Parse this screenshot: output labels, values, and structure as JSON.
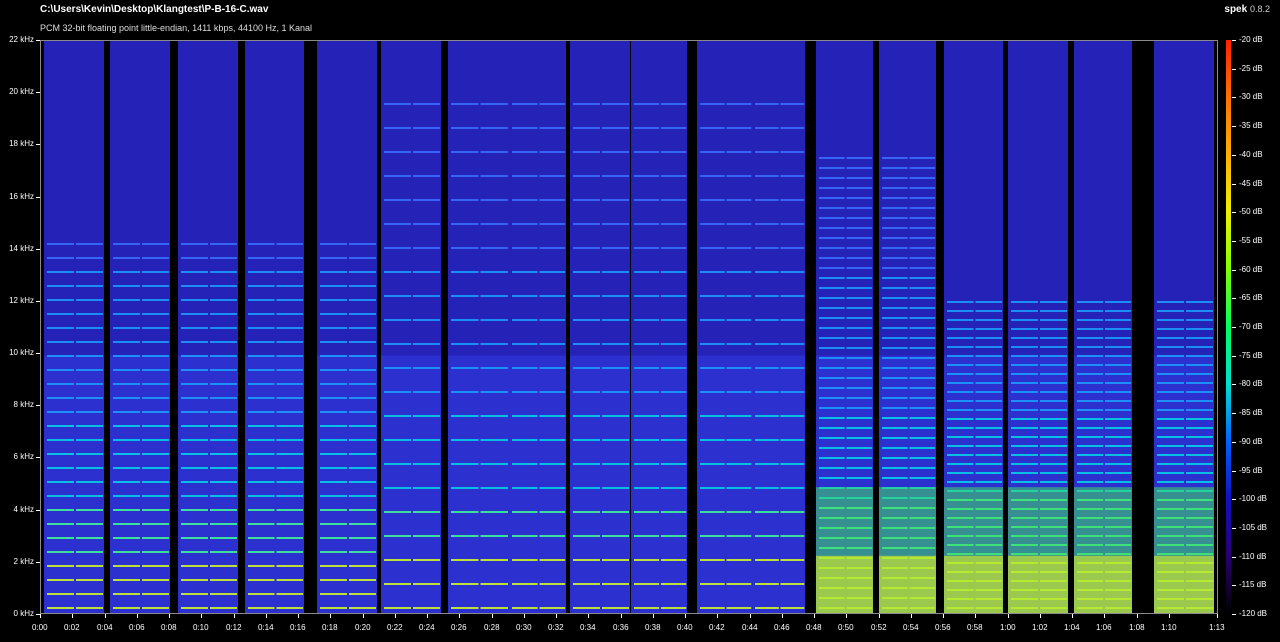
{
  "header": {
    "file_path": "C:\\Users\\Kevin\\Desktop\\Klangtest\\P-B-16-C.wav",
    "file_info": "PCM 32-bit floating point little-endian, 1411 kbps, 44100 Hz, 1 Kanal",
    "app_name": "spek",
    "app_version": "0.8.2"
  },
  "axes": {
    "y_ticks": [
      "22 kHz",
      "20 kHz",
      "18 kHz",
      "16 kHz",
      "14 kHz",
      "12 kHz",
      "10 kHz",
      "8 kHz",
      "6 kHz",
      "4 kHz",
      "2 kHz",
      "0 kHz"
    ],
    "x_ticks": [
      "0:00",
      "0:02",
      "0:04",
      "0:06",
      "0:08",
      "0:10",
      "0:12",
      "0:14",
      "0:16",
      "0:18",
      "0:20",
      "0:22",
      "0:24",
      "0:26",
      "0:28",
      "0:30",
      "0:32",
      "0:34",
      "0:36",
      "0:38",
      "0:40",
      "0:42",
      "0:44",
      "0:46",
      "0:48",
      "0:50",
      "0:52",
      "0:54",
      "0:56",
      "0:58",
      "1:00",
      "1:02",
      "1:04",
      "1:06",
      "1:08",
      "1:10",
      "1:13"
    ]
  },
  "colorbar": {
    "labels": [
      "-20 dB",
      "-25 dB",
      "-30 dB",
      "-35 dB",
      "-40 dB",
      "-45 dB",
      "-50 dB",
      "-55 dB",
      "-60 dB",
      "-65 dB",
      "-70 dB",
      "-75 dB",
      "-80 dB",
      "-85 dB",
      "-90 dB",
      "-95 dB",
      "-100 dB",
      "-105 dB",
      "-110 dB",
      "-115 dB",
      "-120 dB"
    ],
    "colors": [
      "#ff2000",
      "#ff7000",
      "#ffb000",
      "#f0f000",
      "#80ff00",
      "#00ff60",
      "#00e0d0",
      "#0060ff",
      "#1010c0",
      "#2a0070",
      "#000000"
    ]
  }
}
